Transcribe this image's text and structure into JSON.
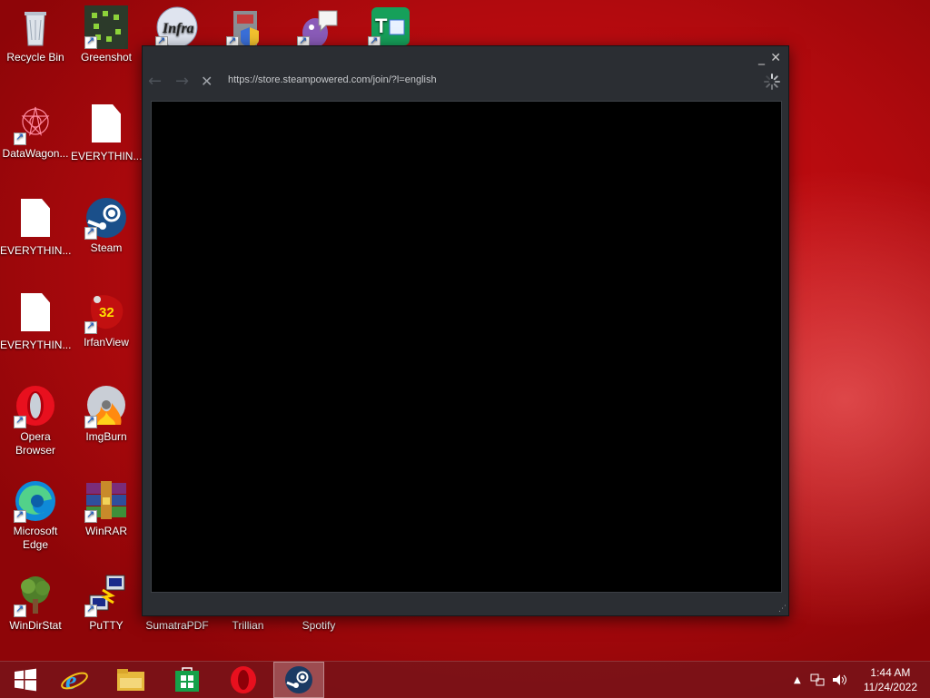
{
  "desktop": {
    "icons": [
      {
        "label": "Recycle Bin"
      },
      {
        "label": "Greenshot"
      },
      {
        "label": "DataWagon..."
      },
      {
        "label": "EVERYTHIN..."
      },
      {
        "label": "EVERYTHIN..."
      },
      {
        "label": "Steam"
      },
      {
        "label": "EVERYTHIN..."
      },
      {
        "label": "IrfanView"
      },
      {
        "label": "Opera Browser"
      },
      {
        "label": "ImgBurn"
      },
      {
        "label": "Microsoft Edge"
      },
      {
        "label": "WinRAR"
      },
      {
        "label": "WinDirStat"
      },
      {
        "label": "PuTTY"
      },
      {
        "label": "SumatraPDF"
      },
      {
        "label": "Trillian"
      },
      {
        "label": "Spotify"
      }
    ],
    "irfanview_badge": "32"
  },
  "steam_window": {
    "url": "https://store.steampowered.com/join/?l=english",
    "minimize_glyph": "_",
    "close_glyph": "✕",
    "back_glyph": "←",
    "forward_glyph": "→",
    "stop_glyph": "✕"
  },
  "taskbar": {
    "pinned": [
      "start-button",
      "internet-explorer",
      "file-explorer",
      "store",
      "opera",
      "steam"
    ],
    "active": "steam",
    "clock": {
      "time": "1:44 AM",
      "date": "11/24/2022"
    }
  },
  "colors": {
    "accent_red": "#c0080d",
    "steam_bg": "#2b2e33",
    "content_bg": "#000000"
  }
}
